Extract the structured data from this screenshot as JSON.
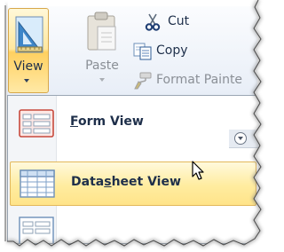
{
  "ribbon": {
    "view_button": {
      "label": "View",
      "icon": "view-design-icon"
    },
    "paste_button": {
      "label": "Paste",
      "icon": "clipboard-icon",
      "enabled": false
    },
    "clipboard_items": [
      {
        "label": "Cut",
        "icon": "scissors-icon",
        "enabled": true
      },
      {
        "label": "Copy",
        "icon": "copy-icon",
        "enabled": true
      },
      {
        "label": "Format Painter",
        "visible_text": "Format Painte",
        "icon": "format-painter-icon",
        "enabled": false
      }
    ]
  },
  "view_menu": {
    "items": [
      {
        "label_pre": "",
        "accelerator": "F",
        "label_post": "orm View",
        "icon": "form-view-icon",
        "highlighted": false
      },
      {
        "label_pre": "Data",
        "accelerator": "s",
        "label_post": "heet View",
        "icon": "datasheet-view-icon",
        "highlighted": true
      },
      {
        "label_pre": "",
        "accelerator": "",
        "label_post": "",
        "icon": "layout-view-icon",
        "highlighted": false
      }
    ]
  },
  "colors": {
    "highlight": "#ffe48a",
    "highlight_border": "#e3b85a",
    "text": "#1e2f4a",
    "disabled_text": "#8a8f96"
  }
}
